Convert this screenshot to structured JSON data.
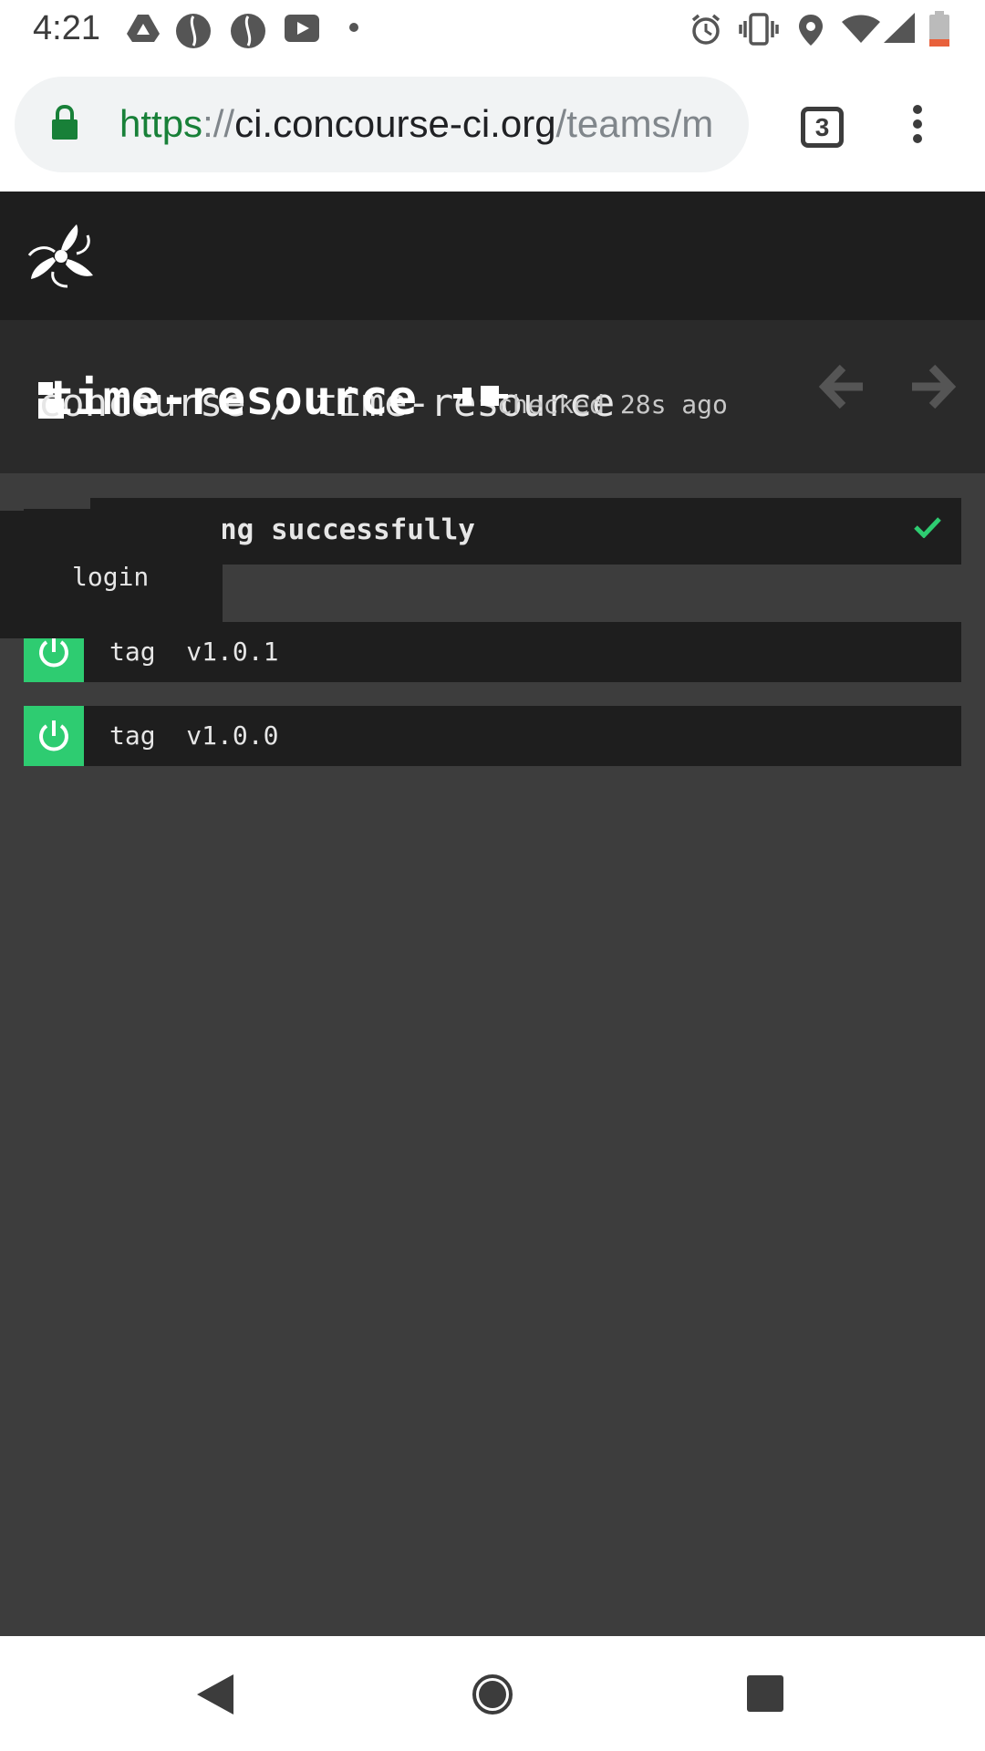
{
  "status_bar": {
    "time": "4:21",
    "left_icons": [
      "drive-icon",
      "coffee-icon",
      "coffee-icon",
      "youtube-icon",
      "dot-icon"
    ],
    "right_icons": [
      "alarm-icon",
      "vibrate-icon",
      "location-icon",
      "wifi-icon",
      "signal-icon",
      "battery-low-icon"
    ]
  },
  "browser": {
    "url_scheme": "https",
    "url_separator": "://",
    "url_host": "ci.concourse-ci.org",
    "url_path": "/teams/m",
    "tab_count": "3"
  },
  "header": {
    "breadcrumb": "concourse / time-resource",
    "resource_title": "time-resource",
    "checked_status": "checked 28s ago"
  },
  "check_status": {
    "text": "checking successfully",
    "visible_text": "ng successfully"
  },
  "versions": [
    {
      "key": "tag",
      "value": "v1.0.1",
      "display": "tag  v1.0.1"
    },
    {
      "key": "tag",
      "value": "v1.0.0",
      "display": "tag  v1.0.0"
    }
  ],
  "login_menu": {
    "label": "login"
  },
  "colors": {
    "accent_green": "#2ecc71",
    "top_bar": "#1e1e1e",
    "header_bg": "#2a2a2a",
    "page_bg": "#3d3d3d",
    "url_scheme_green": "#188038"
  }
}
